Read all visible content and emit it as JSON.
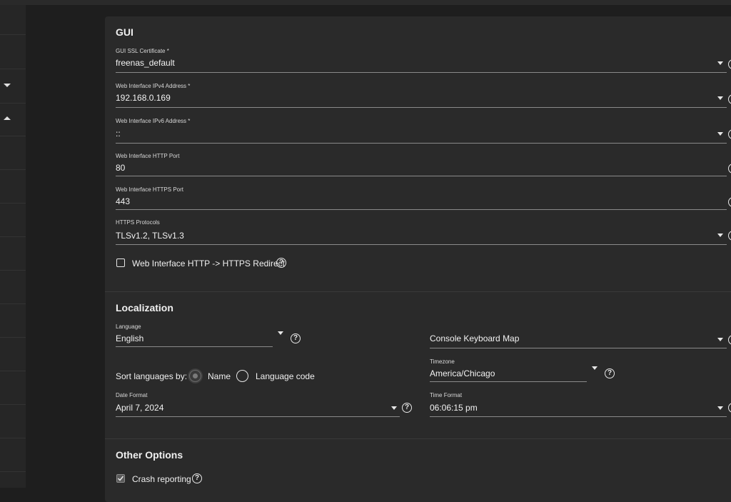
{
  "gui": {
    "title": "GUI",
    "ssl_cert": {
      "label": "GUI SSL Certificate *",
      "value": "freenas_default"
    },
    "ipv4": {
      "label": "Web Interface IPv4 Address *",
      "value": "192.168.0.169"
    },
    "ipv6": {
      "label": "Web Interface IPv6 Address *",
      "value": "::"
    },
    "http_port": {
      "label": "Web Interface HTTP Port",
      "value": "80"
    },
    "https_port": {
      "label": "Web Interface HTTPS Port",
      "value": "443"
    },
    "https_protocols": {
      "label": "HTTPS Protocols",
      "value": "TLSv1.2, TLSv1.3"
    },
    "redirect": {
      "label": "Web Interface HTTP -> HTTPS Redirect",
      "checked": false
    }
  },
  "localization": {
    "title": "Localization",
    "language": {
      "label": "Language",
      "value": "English"
    },
    "console_keymap": {
      "label": "Console Keyboard Map",
      "value": ""
    },
    "sort_by": {
      "label": "Sort languages by:",
      "options": [
        "Name",
        "Language code"
      ],
      "selected": "Name"
    },
    "timezone": {
      "label": "Timezone",
      "value": "America/Chicago"
    },
    "date_format": {
      "label": "Date Format",
      "value": "April 7, 2024"
    },
    "time_format": {
      "label": "Time Format",
      "value": "06:06:15 pm"
    }
  },
  "other": {
    "title": "Other Options",
    "crash_reporting": {
      "label": "Crash reporting",
      "checked": true
    }
  },
  "help_glyph": "?",
  "colors": {
    "background": "#1e1e1e",
    "card": "#2a2a2a",
    "text": "#f0f0f0",
    "underline": "#8a8a8a"
  },
  "icons": [
    "chevron-down-icon",
    "chevron-up-icon",
    "help-circle-icon",
    "checkmark-icon"
  ]
}
